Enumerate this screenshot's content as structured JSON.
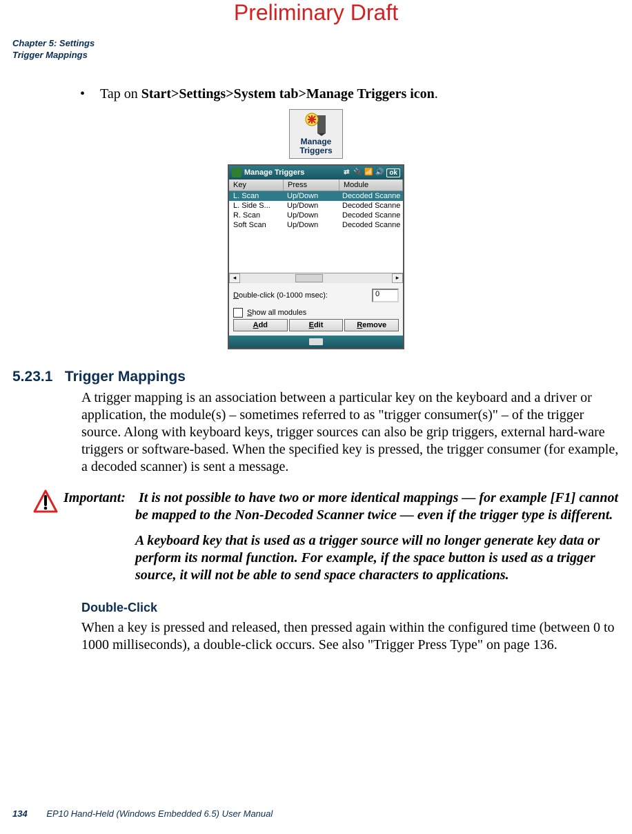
{
  "preliminary": "Preliminary Draft",
  "chapter_line1": "Chapter 5: Settings",
  "chapter_line2": "Trigger Mappings",
  "bullet_prefix": "Tap on ",
  "bullet_bold": "Start>Settings>System tab>Manage Triggers icon",
  "bullet_suffix": ".",
  "shortcut_label": "Manage Triggers",
  "win": {
    "title": "Manage Triggers",
    "ok": "ok",
    "speaker": "🔊",
    "signal": "📶",
    "sync": "⇄",
    "plug": "🔌",
    "headers": {
      "key": "Key",
      "press": "Press",
      "module": "Module"
    },
    "rows": [
      {
        "key": "L. Scan",
        "press": "Up/Down",
        "module": "Decoded Scanne"
      },
      {
        "key": "L. Side S...",
        "press": "Up/Down",
        "module": "Decoded Scanne"
      },
      {
        "key": "R. Scan",
        "press": "Up/Down",
        "module": "Decoded Scanne"
      },
      {
        "key": "Soft Scan",
        "press": "Up/Down",
        "module": "Decoded Scanne"
      }
    ],
    "dc_label_u": "D",
    "dc_label_rest": "ouble-click (0-1000 msec):",
    "dc_value": "0",
    "show_u": "S",
    "show_rest": "how all modules",
    "btn_add_u": "A",
    "btn_add_rest": "dd",
    "btn_edit_u": "E",
    "btn_edit_rest": "dit",
    "btn_remove_u": "R",
    "btn_remove_rest": "emove"
  },
  "sec_num": "5.23.1",
  "sec_title": "Trigger Mappings",
  "para1": "A trigger mapping is an association between a particular key on the keyboard and a driver or application, the module(s) – sometimes referred to as \"trigger consumer(s)\" – of the trigger source. Along with keyboard keys, trigger sources can also be grip triggers, external hard-ware triggers or software-based. When the specified key is pressed, the trigger consumer (for example, a decoded scanner) is sent a message.",
  "important_label": "Important:",
  "important_p1": "It is not possible to have two or more identical mappings — for example [F1] cannot be mapped to the Non-Decoded Scanner twice — even if the trigger type is different.",
  "important_p2": "A keyboard key that is used as a trigger source will no longer generate key data or perform its normal function. For example, if the space button is used as a trigger source, it will not be able to send space characters to applications.",
  "sub_heading": "Double-Click",
  "para2": "When a key is pressed and released, then pressed again within the configured time (between 0 to 1000 milliseconds), a double-click occurs. See also \"Trigger Press Type\" on page 136.",
  "footer_page": "134",
  "footer_text": "EP10 Hand-Held (Windows Embedded 6.5) User Manual"
}
